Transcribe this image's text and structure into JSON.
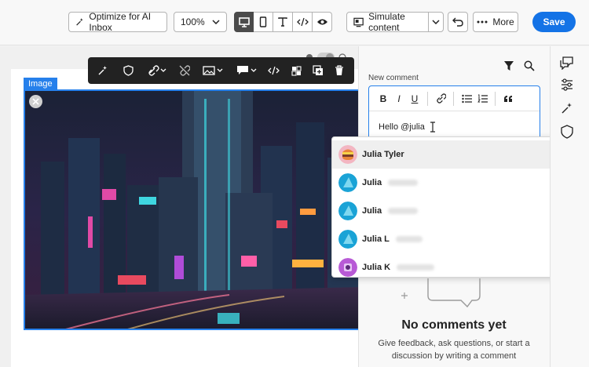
{
  "toolbar": {
    "optimize_label": "Optimize for AI Inbox",
    "zoom_value": "100%",
    "simulate_label": "Simulate content",
    "more_label": "More",
    "save_label": "Save"
  },
  "canvas": {
    "image_tag": "Image"
  },
  "comments": {
    "new_comment_label": "New comment",
    "input_value": "Hello @julia",
    "mentions": [
      {
        "first": "Julia Tyler",
        "avatar": "julia-tyler-avatar"
      },
      {
        "first": "Julia",
        "avatar": "teal-triangle-avatar"
      },
      {
        "first": "Julia",
        "avatar": "teal-triangle-avatar"
      },
      {
        "first": "Julia L",
        "avatar": "teal-triangle-avatar"
      },
      {
        "first": "Julia K",
        "avatar": "purple-avatar"
      }
    ],
    "empty_title": "No comments yet",
    "empty_desc": "Give feedback, ask questions, or start a discussion by writing a comment"
  },
  "colors": {
    "accent": "#1473e6",
    "selection": "#2680eb",
    "toolbar_dark": "#222222"
  }
}
